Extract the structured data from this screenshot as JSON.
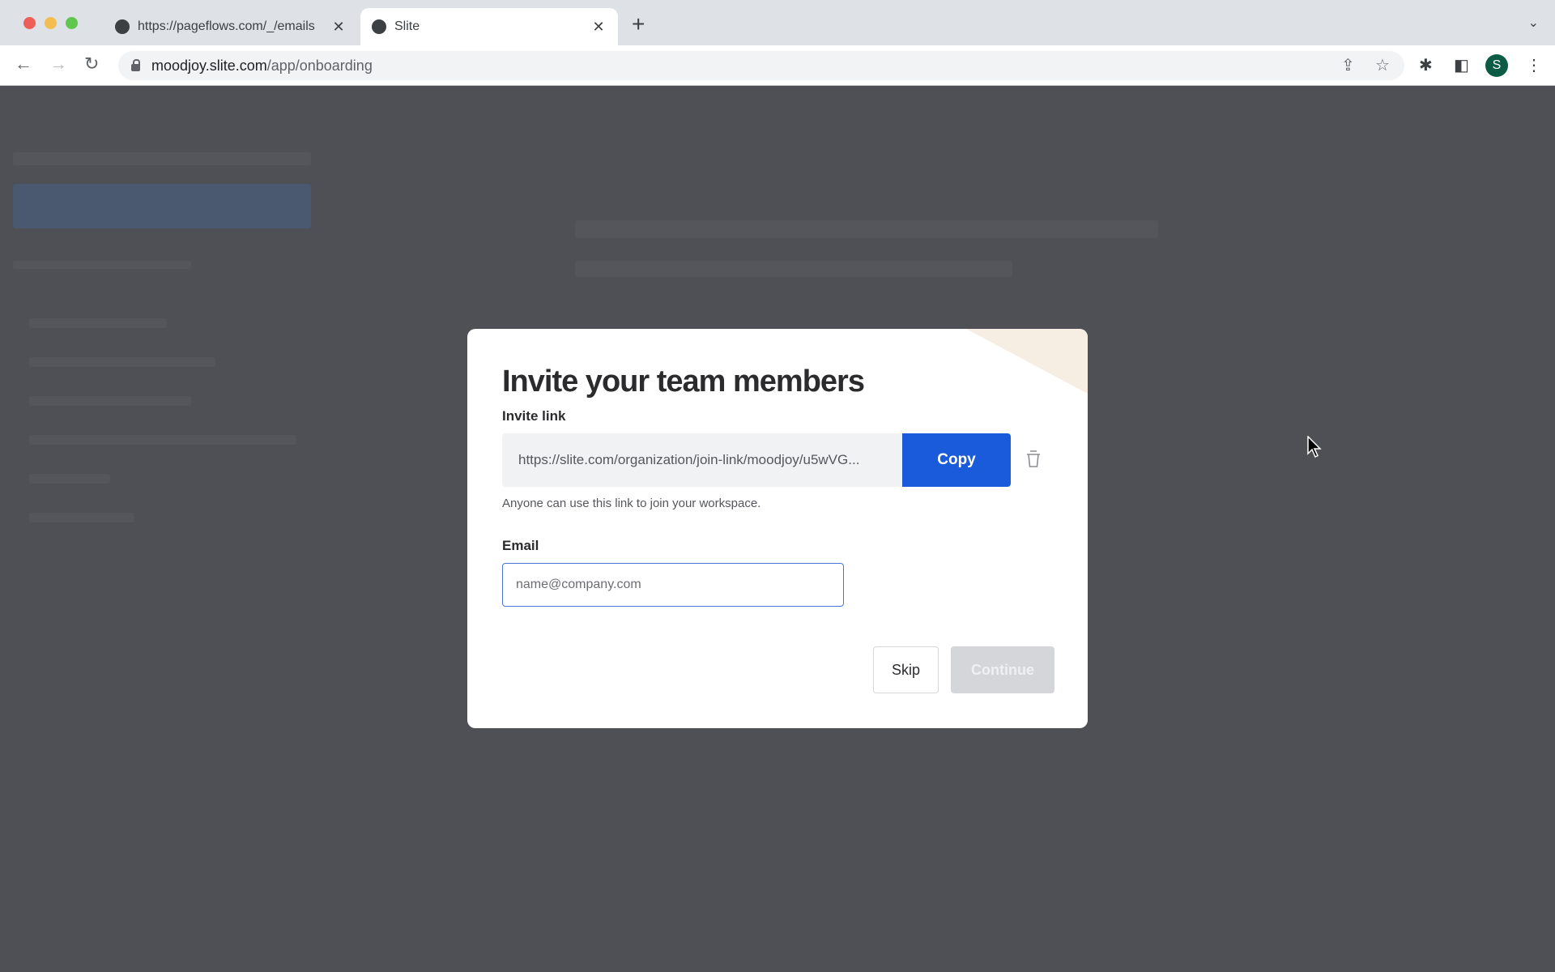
{
  "browser": {
    "tabs": [
      {
        "title": "https://pageflows.com/_/emails",
        "icon": "globe-icon",
        "active": false
      },
      {
        "title": "Slite",
        "icon": "slite-logo-icon",
        "active": true
      }
    ],
    "url_host": "moodjoy.slite.com",
    "url_path": "/app/onboarding",
    "profile_initial": "S",
    "profile_color": "#0b5b45"
  },
  "modal": {
    "title": "Invite your team members",
    "invite_link_label": "Invite link",
    "invite_link_value": "https://slite.com/organization/join-link/moodjoy/u5wVG...",
    "copy_label": "Copy",
    "help_text": "Anyone can use this link to join your workspace.",
    "email_label": "Email",
    "email_placeholder": "name@company.com",
    "email_value": "",
    "skip_label": "Skip",
    "continue_label": "Continue",
    "continue_disabled": true,
    "accent_color": "#1a5bdb"
  }
}
